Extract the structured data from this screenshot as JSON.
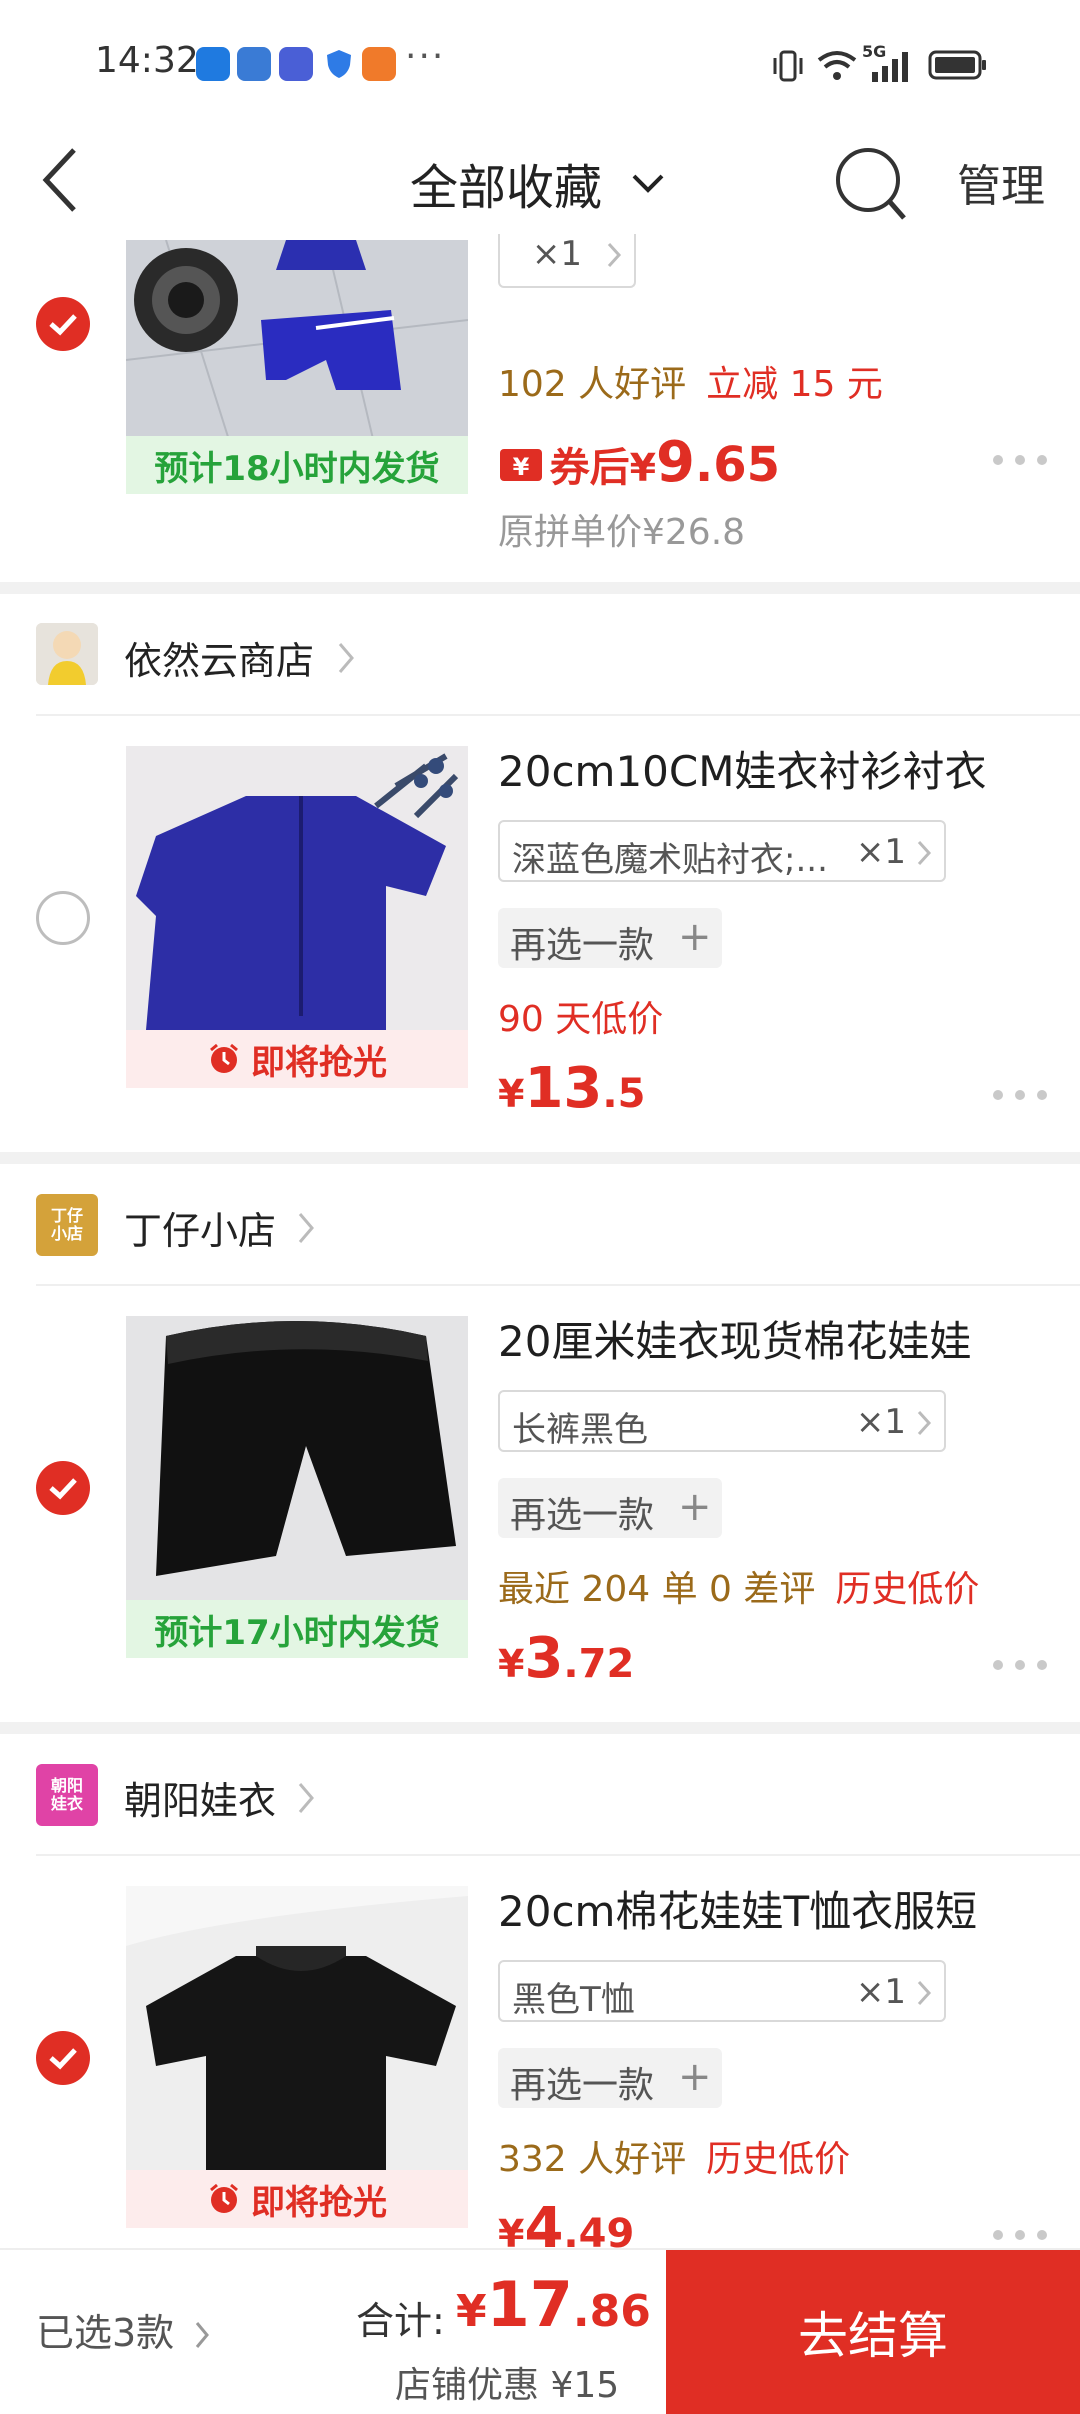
{
  "status_bar": {
    "time": "14:32",
    "more": "···",
    "network": "5G"
  },
  "nav": {
    "title": "全部收藏",
    "manage": "管理"
  },
  "item0": {
    "qty": "×1",
    "reviews": "102 人好评",
    "promo": "立减 15 元",
    "price_prefix": "券后",
    "price_symbol": "¥",
    "price_int": "9",
    "price_dec": ".65",
    "original": "原拼单价¥26.8",
    "ship_tag": "预计18小时内发货"
  },
  "shop1": {
    "name": "依然云商店"
  },
  "item1": {
    "title": "20cm10CM娃衣衬衫衬衣",
    "spec": "深蓝色魔术贴衬衣;...",
    "qty": "×1",
    "reselect": "再选一款",
    "note": "90 天低价",
    "price_symbol": "¥",
    "price_int": "13",
    "price_dec": ".5",
    "tag": "即将抢光"
  },
  "shop2": {
    "name": "丁仔小店",
    "logo_text": "丁仔小店"
  },
  "item2": {
    "title": "20厘米娃衣现货棉花娃娃",
    "spec": "长裤黑色",
    "qty": "×1",
    "reselect": "再选一款",
    "sales": "最近 204 单 0 差评",
    "badge": "历史低价",
    "price_symbol": "¥",
    "price_int": "3",
    "price_dec": ".72",
    "ship_tag": "预计17小时内发货"
  },
  "shop3": {
    "name": "朝阳娃衣",
    "logo_text": "朝阳娃衣"
  },
  "item3": {
    "title": "20cm棉花娃娃T恤衣服短",
    "spec": "黑色T恤",
    "qty": "×1",
    "reselect": "再选一款",
    "reviews": "332 人好评",
    "badge": "历史低价",
    "price_symbol": "¥",
    "price_int": "4",
    "price_dec": ".49",
    "tag": "即将抢光"
  },
  "bottom": {
    "selected": "已选3款",
    "total_label": "合计:",
    "total_symbol": "¥",
    "total_int": "17",
    "total_dec": ".86",
    "discount": "店铺优惠 ¥15",
    "checkout": "去结算"
  },
  "colors": {
    "accent": "#e02e24",
    "green": "#26a33a",
    "gold": "#9b6a1a"
  }
}
